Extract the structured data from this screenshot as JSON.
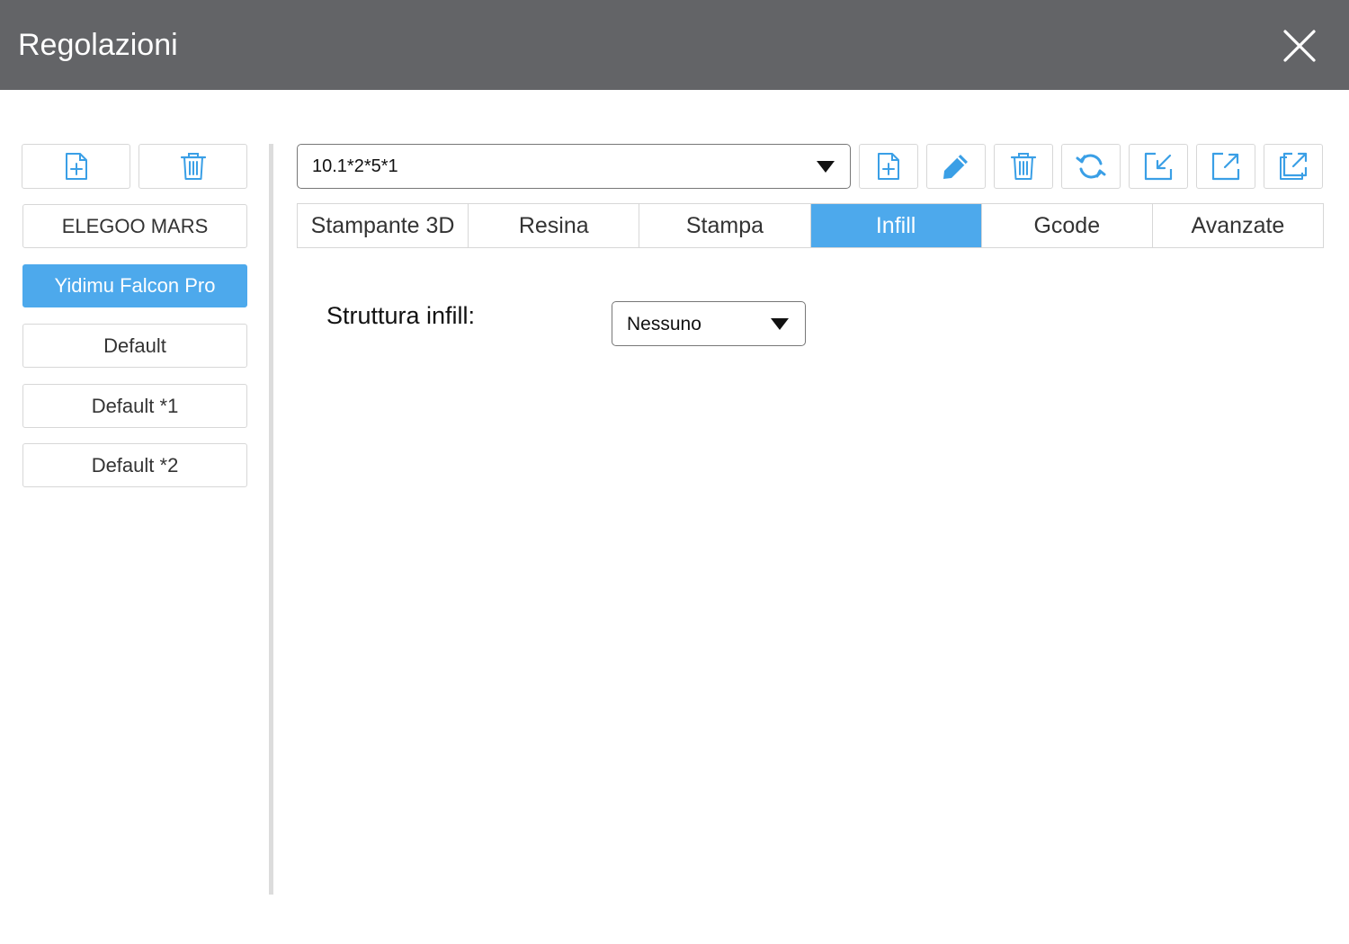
{
  "window": {
    "title": "Regolazioni"
  },
  "icons": {
    "close": "close-icon",
    "add": "file-plus-icon",
    "delete": "trash-icon",
    "edit": "pencil-icon",
    "refresh": "refresh-icon",
    "import": "import-icon",
    "export": "export-icon",
    "export_all": "export-all-icon"
  },
  "colors": {
    "accent": "#4da9ec",
    "titlebar": "#636467"
  },
  "sidebar": {
    "items": [
      {
        "label": "ELEGOO MARS",
        "active": false
      },
      {
        "label": "Yidimu Falcon Pro",
        "active": true
      },
      {
        "label": "Default",
        "active": false
      },
      {
        "label": "Default *1",
        "active": false
      },
      {
        "label": "Default *2",
        "active": false
      }
    ]
  },
  "profile": {
    "selected": "10.1*2*5*1"
  },
  "tabs": [
    {
      "label": "Stampante 3D",
      "active": false
    },
    {
      "label": "Resina",
      "active": false
    },
    {
      "label": "Stampa",
      "active": false
    },
    {
      "label": "Infill",
      "active": true
    },
    {
      "label": "Gcode",
      "active": false
    },
    {
      "label": "Avanzate",
      "active": false
    }
  ],
  "infill": {
    "structure_label": "Struttura infill:",
    "structure_value": "Nessuno"
  }
}
